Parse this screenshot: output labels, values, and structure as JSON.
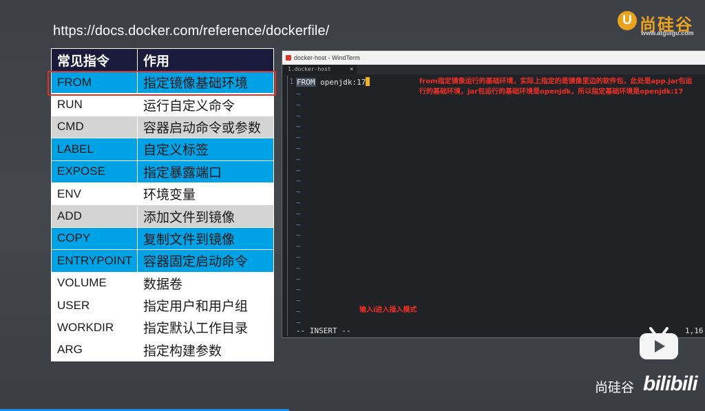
{
  "url": "https://docs.docker.com/reference/dockerfile/",
  "logo": {
    "letter": "U",
    "name": "尚硅谷",
    "site": "www.atguigu.com"
  },
  "table": {
    "headers": [
      "常见指令",
      "作用"
    ],
    "rows": [
      {
        "cmd": "FROM",
        "desc": "指定镜像基础环境",
        "style": "blue"
      },
      {
        "cmd": "RUN",
        "desc": "运行自定义命令",
        "style": "white"
      },
      {
        "cmd": "CMD",
        "desc": "容器启动命令或参数",
        "style": "gray"
      },
      {
        "cmd": "LABEL",
        "desc": "自定义标签",
        "style": "blue"
      },
      {
        "cmd": "EXPOSE",
        "desc": "指定暴露端口",
        "style": "blue"
      },
      {
        "cmd": "ENV",
        "desc": "环境变量",
        "style": "white"
      },
      {
        "cmd": "ADD",
        "desc": "添加文件到镜像",
        "style": "gray"
      },
      {
        "cmd": "COPY",
        "desc": "复制文件到镜像",
        "style": "blue"
      },
      {
        "cmd": "ENTRYPOINT",
        "desc": "容器固定启动命令",
        "style": "blue"
      },
      {
        "cmd": "VOLUME",
        "desc": "数据卷",
        "style": "white"
      },
      {
        "cmd": "USER",
        "desc": "指定用户和用户组",
        "style": "white"
      },
      {
        "cmd": "WORKDIR",
        "desc": "指定默认工作目录",
        "style": "white"
      },
      {
        "cmd": "ARG",
        "desc": "指定构建参数",
        "style": "white"
      }
    ]
  },
  "terminal": {
    "window_title": "docker-host - WindTerm",
    "tab_label": "1.docker-host",
    "tab_close": "×",
    "line_number": "1",
    "code_keyword": "FROM",
    "code_rest": " openjdk:17",
    "tilde": "~",
    "tilde_count": 22,
    "mode_line": "-- INSERT --",
    "cursor_pos": "1,16",
    "note": "from指定镜像运行的基础环境，实际上指定的是镜像里边的软件包，此处是app.jar包运行的基础环境，jar包运行的基础环境是openjdk，所以指定基础环境是openjdk:17",
    "note2": "输入i进入插入模式"
  },
  "brand": {
    "name": "尚硅谷",
    "bili": "bilibili"
  },
  "colors": {
    "blue_row": "#00a2e6",
    "gray_row": "#d4d4d4",
    "header": "#1a1a3c",
    "annotation": "#f02f25",
    "highlight": "#e0302a"
  }
}
